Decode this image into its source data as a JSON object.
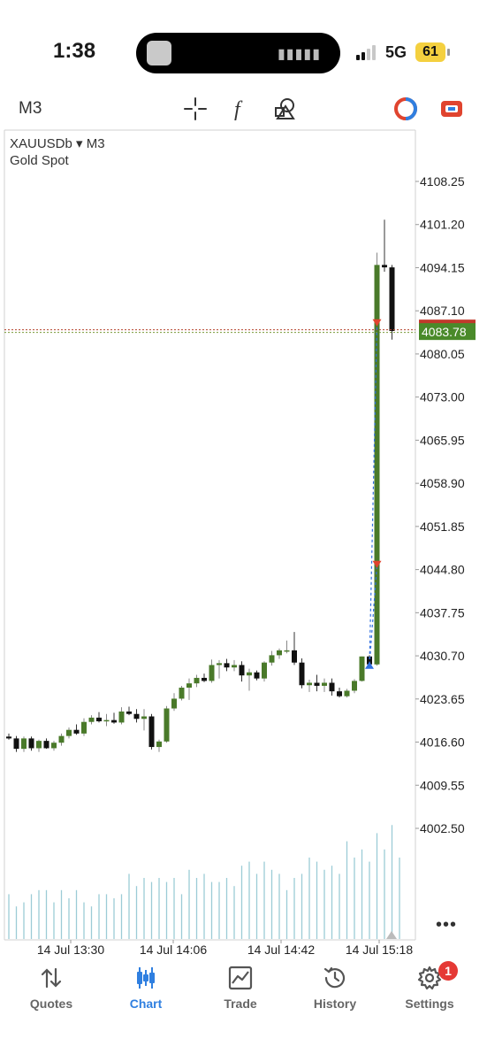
{
  "status_bar": {
    "time": "1:38",
    "network": "5G",
    "battery": "61"
  },
  "toolbar": {
    "timeframe": "M3",
    "icons": [
      "crosshair-icon",
      "function-icon",
      "objects-icon",
      "one-click-trading-icon",
      "accounts-icon"
    ]
  },
  "chart": {
    "symbol": "XAUUSDb",
    "timeframe": "M3",
    "description": "Gold Spot",
    "current_price": "4083.78",
    "more_label": "•••"
  },
  "chart_data": {
    "type": "candlestick",
    "y_ticks": [
      "4108.25",
      "4101.20",
      "4094.15",
      "4087.10",
      "4080.05",
      "4073.00",
      "4065.95",
      "4058.90",
      "4051.85",
      "4044.80",
      "4037.75",
      "4030.70",
      "4023.65",
      "4016.60",
      "4009.55",
      "4002.50"
    ],
    "x_ticks": [
      "14 Jul 13:30",
      "14 Jul 14:06",
      "14 Jul 14:42",
      "14 Jul 15:18"
    ],
    "ylim": [
      3997,
      4111
    ],
    "last_price": 4083.78,
    "candles": [
      [
        4017.5,
        4018.0,
        4017.0,
        4017.2
      ],
      [
        4017.2,
        4017.6,
        4015.0,
        4015.5
      ],
      [
        4015.5,
        4017.5,
        4015.0,
        4017.2
      ],
      [
        4017.2,
        4017.5,
        4015.2,
        4015.6
      ],
      [
        4015.6,
        4017.0,
        4015.0,
        4016.8
      ],
      [
        4016.8,
        4017.2,
        4015.5,
        4015.6
      ],
      [
        4015.6,
        4016.8,
        4015.2,
        4016.5
      ],
      [
        4016.5,
        4018.0,
        4016.0,
        4017.6
      ],
      [
        4017.6,
        4019.0,
        4017.2,
        4018.6
      ],
      [
        4018.6,
        4019.5,
        4017.8,
        4018.0
      ],
      [
        4018.0,
        4020.5,
        4017.6,
        4019.9
      ],
      [
        4019.9,
        4021.0,
        4019.5,
        4020.6
      ],
      [
        4020.6,
        4021.5,
        4019.8,
        4020.0
      ],
      [
        4020.0,
        4021.2,
        4019.2,
        4020.2
      ],
      [
        4020.2,
        4021.4,
        4019.6,
        4019.8
      ],
      [
        4019.8,
        4022.3,
        4019.5,
        4021.6
      ],
      [
        4021.6,
        4022.4,
        4021.0,
        4021.2
      ],
      [
        4021.2,
        4022.0,
        4019.8,
        4020.4
      ],
      [
        4020.4,
        4022.0,
        4018.5,
        4020.8
      ],
      [
        4020.8,
        4021.2,
        4015.4,
        4015.8
      ],
      [
        4015.8,
        4017.0,
        4015.0,
        4016.7
      ],
      [
        4016.7,
        4022.5,
        4016.5,
        4022.1
      ],
      [
        4022.1,
        4024.6,
        4021.7,
        4023.7
      ],
      [
        4023.7,
        4025.8,
        4023.4,
        4025.5
      ],
      [
        4025.5,
        4027.0,
        4023.5,
        4026.2
      ],
      [
        4026.2,
        4027.6,
        4025.6,
        4027.1
      ],
      [
        4027.1,
        4027.8,
        4026.4,
        4026.6
      ],
      [
        4026.6,
        4030.1,
        4026.3,
        4029.2
      ],
      [
        4029.2,
        4030.0,
        4027.0,
        4029.5
      ],
      [
        4029.5,
        4030.2,
        4028.2,
        4028.8
      ],
      [
        4028.8,
        4030.0,
        4028.2,
        4029.2
      ],
      [
        4029.2,
        4029.8,
        4026.5,
        4027.5
      ],
      [
        4027.5,
        4028.6,
        4025.0,
        4028.0
      ],
      [
        4028.0,
        4028.3,
        4026.7,
        4027.0
      ],
      [
        4027.0,
        4029.8,
        4026.5,
        4029.6
      ],
      [
        4029.6,
        4031.5,
        4029.1,
        4030.8
      ],
      [
        4030.8,
        4031.9,
        4030.2,
        4031.6
      ],
      [
        4031.6,
        4033.2,
        4031.1,
        4031.6
      ],
      [
        4031.6,
        4034.6,
        4029.2,
        4029.6
      ],
      [
        4029.6,
        4030.3,
        4025.4,
        4025.9
      ],
      [
        4025.9,
        4026.8,
        4024.8,
        4026.3
      ],
      [
        4026.3,
        4027.6,
        4024.9,
        4025.8
      ],
      [
        4025.8,
        4027.0,
        4024.8,
        4026.3
      ],
      [
        4026.3,
        4027.0,
        4024.2,
        4024.9
      ],
      [
        4024.9,
        4025.5,
        4023.9,
        4024.1
      ],
      [
        4024.1,
        4025.3,
        4023.9,
        4025.0
      ],
      [
        4025.0,
        4026.9,
        4024.6,
        4026.6
      ],
      [
        4026.6,
        4030.6,
        4026.5,
        4030.6
      ],
      [
        4030.6,
        4030.8,
        4029.0,
        4029.3
      ],
      [
        4029.3,
        4096.6,
        4029.1,
        4094.6
      ],
      [
        4094.6,
        4102.0,
        4093.5,
        4094.2
      ],
      [
        4094.2,
        4094.6,
        4082.4,
        4083.8
      ]
    ],
    "volume": [
      55,
      40,
      45,
      55,
      60,
      60,
      45,
      60,
      50,
      60,
      45,
      40,
      55,
      55,
      50,
      55,
      80,
      65,
      75,
      70,
      75,
      70,
      75,
      55,
      85,
      75,
      80,
      70,
      70,
      75,
      65,
      90,
      95,
      80,
      95,
      85,
      80,
      60,
      75,
      80,
      100,
      95,
      85,
      90,
      80,
      120,
      100,
      110,
      95,
      130,
      110,
      140,
      100
    ]
  },
  "tabs": [
    {
      "label": "Quotes",
      "icon": "quotes-arrows-icon"
    },
    {
      "label": "Chart",
      "icon": "candlestick-chart-icon"
    },
    {
      "label": "Trade",
      "icon": "trade-line-chart-icon"
    },
    {
      "label": "History",
      "icon": "history-clock-icon"
    },
    {
      "label": "Settings",
      "icon": "settings-gear-icon"
    }
  ],
  "settings_badge": "1",
  "colors": {
    "bull": "#4a7a2a",
    "bear": "#111111",
    "active_tab": "#2f7fe0",
    "price_label": "#4a8a2a",
    "price_line": "#b5422b"
  }
}
